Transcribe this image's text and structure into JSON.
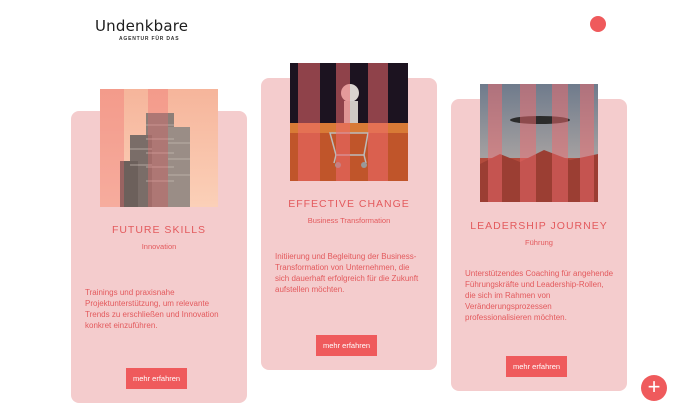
{
  "header": {
    "logo_word": "Undenkbare",
    "logo_tagline": "AGENTUR FÜR DAS",
    "menu_icon": "circle-menu-icon"
  },
  "cards": [
    {
      "title": "FUTURE SKILLS",
      "subtitle": "Innovation",
      "description": "Trainings und praxisnahe Projektunterstützung, um relevante Trends zu erschließen und Innovation konkret einzuführen.",
      "button": "mehr erfahren",
      "image": "towers-image"
    },
    {
      "title": "EFFECTIVE CHANGE",
      "subtitle": "Business Transformation",
      "description": "Initiierung und Begleitung der Business-Transformation von Unternehmen, die sich dauerhaft erfolgreich für die Zukunft aufstellen möchten.",
      "button": "mehr erfahren",
      "image": "astronaut-cart-image"
    },
    {
      "title": "LEADERSHIP JOURNEY",
      "subtitle": "Führung",
      "description": "Unterstützendes Coaching für angehende Führungskräfte und Leadership-Rollen, die sich im Rahmen von Veränderungsprozessen professionalisieren möchten.",
      "button": "mehr erfahren",
      "image": "desert-ufo-image"
    }
  ],
  "fab_icon": "plus-icon",
  "fab_label": "+",
  "colors": {
    "accent": "#ef5a5c",
    "card_bg": "#f4cccd",
    "text_accent": "#e35a5d"
  }
}
